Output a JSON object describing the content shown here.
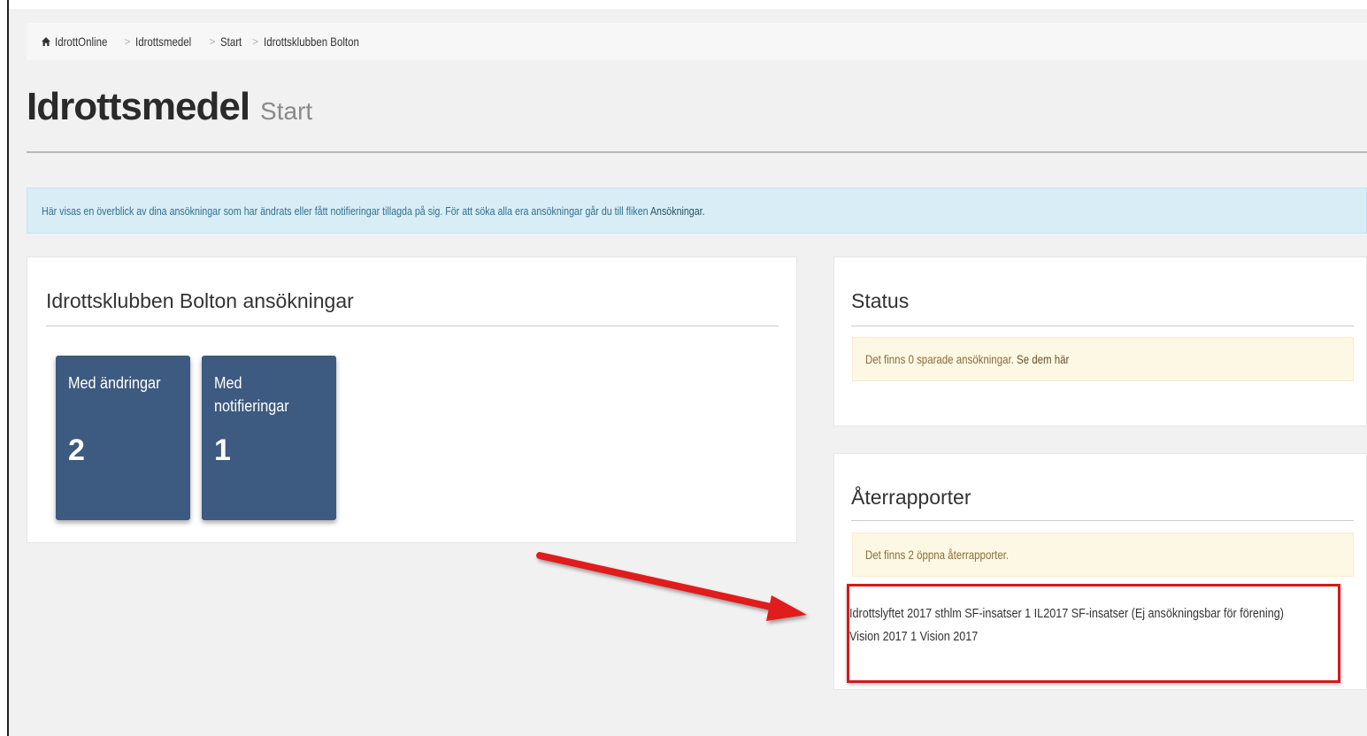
{
  "breadcrumb": {
    "items": [
      "IdrottOnline",
      "Idrottsmedel",
      "Start",
      "Idrottsklubben Bolton"
    ]
  },
  "header": {
    "title": "Idrottsmedel",
    "subtitle": "Start"
  },
  "info": {
    "text": "Här visas en överblick av dina ansökningar som har ändrats eller fått notifieringar tillagda på sig. För att söka alla era ansökningar går du till fliken ",
    "link": "Ansökningar."
  },
  "applications": {
    "title": "Idrottsklubben Bolton ansökningar",
    "tiles": [
      {
        "label": "Med ändringar",
        "count": "2"
      },
      {
        "label": "Med notifieringar",
        "count": "1"
      }
    ]
  },
  "status": {
    "title": "Status",
    "alert_text": "Det finns 0 sparade ansökningar. ",
    "alert_link": "Se dem här"
  },
  "reports": {
    "title": "Återrapporter",
    "alert_text": "Det finns 2 öppna återrapporter.",
    "items": [
      "Idrottslyftet 2017 sthlm SF-insatser 1 IL2017 SF-insatser (Ej ansökningsbar för förening)",
      "Vision 2017 1 Vision 2017"
    ]
  },
  "colors": {
    "tile": "#3d5a80",
    "highlight": "#d21a1a",
    "info_bg": "#d9edf7",
    "warning_bg": "#fcf8e3"
  },
  "icons": {
    "home": "home-icon"
  }
}
